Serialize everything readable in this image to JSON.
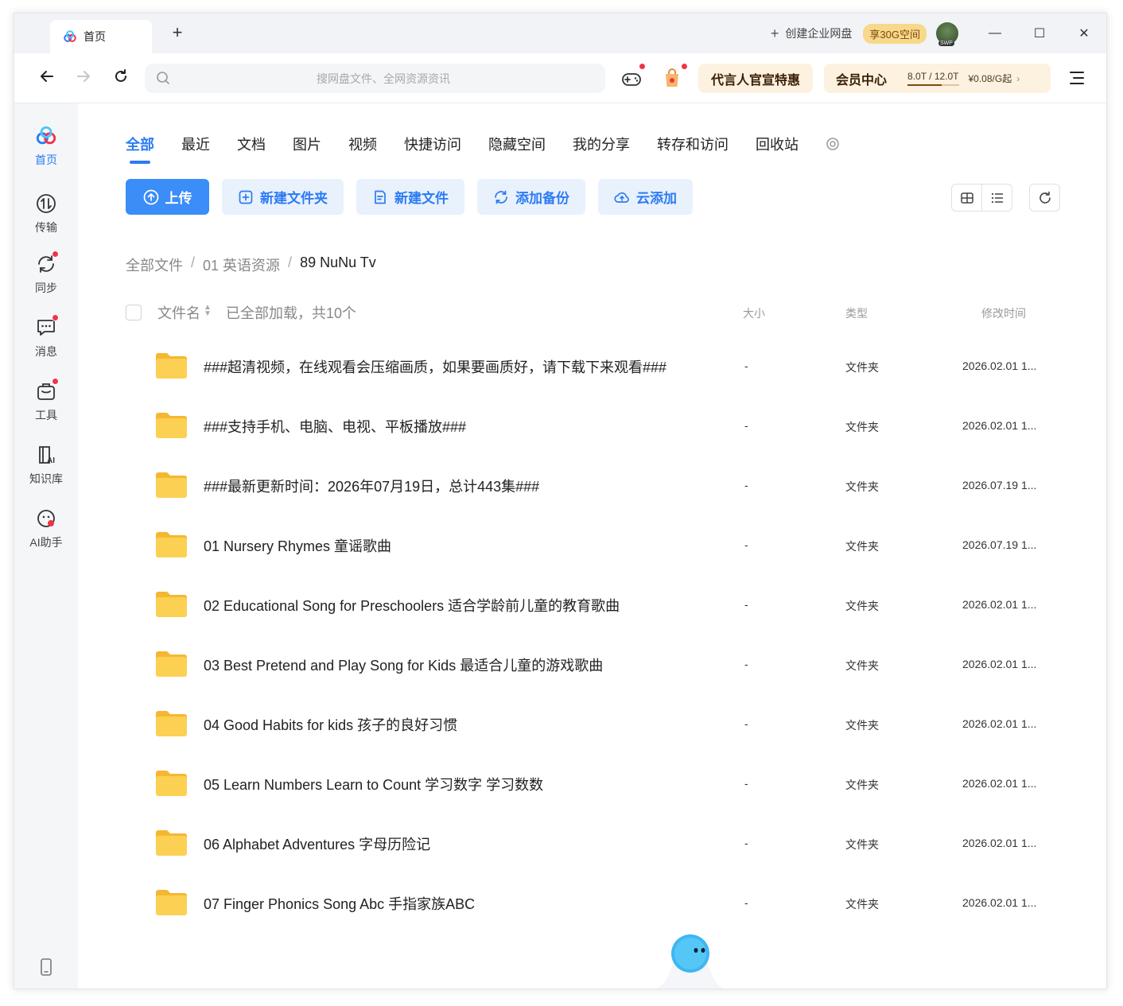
{
  "app": {
    "tab_title": "首页",
    "new_tab": "+",
    "create_enterprise": "创建企业网盘",
    "space_badge": "享30G空间",
    "window_min": "—",
    "window_max": "☐",
    "window_close": "✕"
  },
  "toolbar": {
    "search_placeholder": "搜网盘文件、全网资源资讯",
    "promo_label": "代言人官宣特惠",
    "vip_label": "会员中心",
    "quota_text": "8.0T / 12.0T",
    "quota_fraction": 0.667,
    "price_text": "¥0.08/G起",
    "price_chevron": "›"
  },
  "sidebar": {
    "items": [
      {
        "label": "首页",
        "icon": "baidu-cloud-logo-icon",
        "active": true
      },
      {
        "label": "传输",
        "icon": "transfer-icon"
      },
      {
        "label": "同步",
        "icon": "sync-icon",
        "badge": true
      },
      {
        "label": "消息",
        "icon": "message-icon",
        "badge": true
      },
      {
        "label": "工具",
        "icon": "toolbox-icon",
        "badge": true
      },
      {
        "label": "知识库",
        "icon": "ai-knowledge-icon"
      },
      {
        "label": "AI助手",
        "icon": "ai-assistant-icon"
      }
    ]
  },
  "categories": [
    "全部",
    "最近",
    "文档",
    "图片",
    "视频",
    "快捷访问",
    "隐藏空间",
    "我的分享",
    "转存和访问",
    "回收站"
  ],
  "actions": {
    "upload": "上传",
    "new_folder": "新建文件夹",
    "new_file": "新建文件",
    "add_backup": "添加备份",
    "cloud_add": "云添加"
  },
  "breadcrumb": {
    "root": "全部文件",
    "level1": "01 英语资源",
    "current": "89 NuNu Tv",
    "sep": "/"
  },
  "list_header": {
    "name": "文件名",
    "loaded": "已全部加载，共10个",
    "size": "大小",
    "type": "类型",
    "modified": "修改时间"
  },
  "files": [
    {
      "name": "###超清视频，在线观看会压缩画质，如果要画质好，请下载下来观看###",
      "size": "-",
      "type": "文件夹",
      "modified": "2026.02.01 1..."
    },
    {
      "name": "###支持手机、电脑、电视、平板播放###",
      "size": "-",
      "type": "文件夹",
      "modified": "2026.02.01 1..."
    },
    {
      "name": "###最新更新时间：2026年07月19日，总计443集###",
      "size": "-",
      "type": "文件夹",
      "modified": "2026.07.19 1..."
    },
    {
      "name": "01 Nursery Rhymes 童谣歌曲",
      "size": "-",
      "type": "文件夹",
      "modified": "2026.07.19 1..."
    },
    {
      "name": "02 Educational Song for Preschoolers 适合学龄前儿童的教育歌曲",
      "size": "-",
      "type": "文件夹",
      "modified": "2026.02.01 1..."
    },
    {
      "name": "03 Best Pretend and Play Song for Kids 最适合儿童的游戏歌曲",
      "size": "-",
      "type": "文件夹",
      "modified": "2026.02.01 1..."
    },
    {
      "name": "04 Good Habits for kids 孩子的良好习惯",
      "size": "-",
      "type": "文件夹",
      "modified": "2026.02.01 1..."
    },
    {
      "name": "05 Learn Numbers Learn to Count 学习数字 学习数数",
      "size": "-",
      "type": "文件夹",
      "modified": "2026.02.01 1..."
    },
    {
      "name": "06 Alphabet Adventures 字母历险记",
      "size": "-",
      "type": "文件夹",
      "modified": "2026.02.01 1..."
    },
    {
      "name": "07 Finger Phonics Song Abc 手指家族ABC",
      "size": "-",
      "type": "文件夹",
      "modified": "2026.02.01 1..."
    }
  ],
  "colors": {
    "accent": "#2b7bf4",
    "primary_button": "#3b8df8",
    "secondary_button_bg": "#e9f1fd",
    "promo_bg": "#fdf1e0",
    "badge_red": "#f0334c",
    "folder_yellow": "#fcd053"
  }
}
